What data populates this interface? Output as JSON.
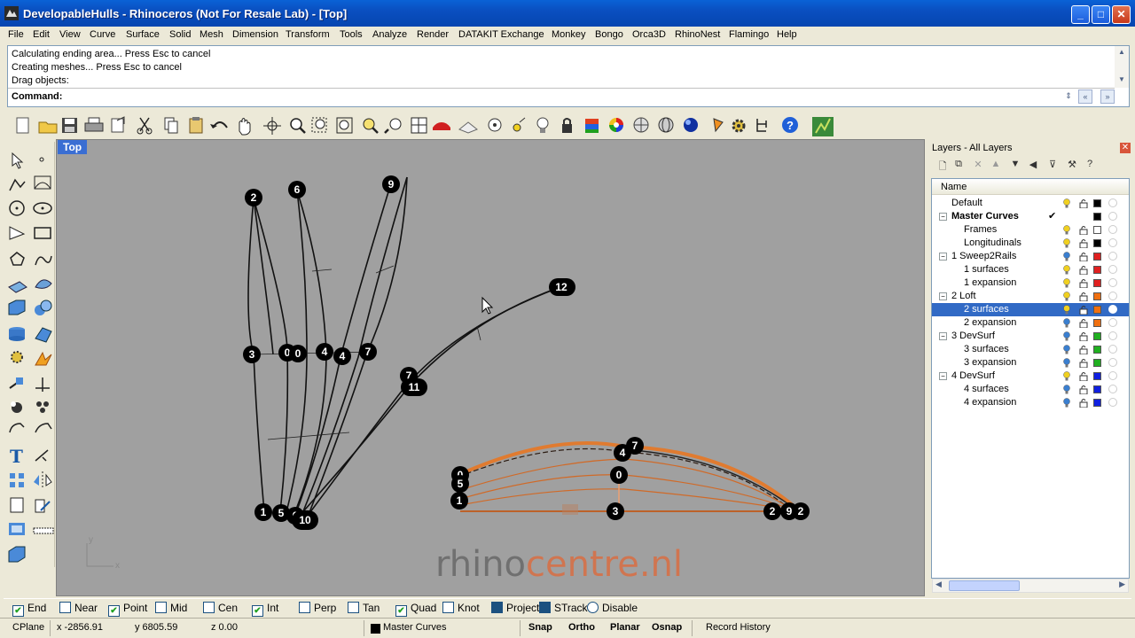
{
  "window": {
    "title": "DevelopableHulls - Rhinoceros (Not For Resale Lab) - [Top]",
    "buttons": {
      "minimize": "_",
      "maximize": "□",
      "close": "✕"
    }
  },
  "menu": [
    "File",
    "Edit",
    "View",
    "Curve",
    "Surface",
    "Solid",
    "Mesh",
    "Dimension",
    "Transform",
    "Tools",
    "Analyze",
    "Render",
    "DATAKIT Exchange",
    "Monkey",
    "Bongo",
    "Orca3D",
    "RhinoNest",
    "Flamingo",
    "Help"
  ],
  "command": {
    "history": [
      "Calculating ending area... Press Esc to cancel",
      "Creating meshes... Press Esc to cancel",
      "Drag objects:"
    ],
    "label": "Command:",
    "value": ""
  },
  "viewport": {
    "name": "Top",
    "watermark_a": "rhino",
    "watermark_b": "centre.nl",
    "axis_y": "y",
    "axis_x": "x",
    "labels_left": [
      "2",
      "6",
      "9",
      "12",
      "3",
      "0",
      "0",
      "4",
      "4",
      "7",
      "7",
      "11",
      "1",
      "5",
      "0",
      "10"
    ],
    "labels_right": [
      "7",
      "4",
      "0",
      "0",
      "5",
      "1",
      "3",
      "2",
      "9",
      "2"
    ]
  },
  "layers": {
    "title": "Layers - All Layers",
    "column": "Name",
    "rows": [
      {
        "name": "Default",
        "indent": 0,
        "bold": false,
        "expander": "",
        "current": false,
        "bulb": "#f0d020",
        "color": "#000000"
      },
      {
        "name": "Master Curves",
        "indent": 0,
        "bold": true,
        "expander": "−",
        "current": true,
        "bulb": "",
        "color": "#000000"
      },
      {
        "name": "Frames",
        "indent": 1,
        "bold": false,
        "expander": "",
        "current": false,
        "bulb": "#f0d020",
        "color": "#ffffff"
      },
      {
        "name": "Longitudinals",
        "indent": 1,
        "bold": false,
        "expander": "",
        "current": false,
        "bulb": "#f0d020",
        "color": "#000000"
      },
      {
        "name": "1 Sweep2Rails",
        "indent": 0,
        "bold": false,
        "expander": "−",
        "current": false,
        "bulb": "#3a7fd0",
        "color": "#e02020"
      },
      {
        "name": "1 surfaces",
        "indent": 1,
        "bold": false,
        "expander": "",
        "current": false,
        "bulb": "#f0d020",
        "color": "#e02020"
      },
      {
        "name": "1 expansion",
        "indent": 1,
        "bold": false,
        "expander": "",
        "current": false,
        "bulb": "#f0d020",
        "color": "#e02020"
      },
      {
        "name": "2 Loft",
        "indent": 0,
        "bold": false,
        "expander": "−",
        "current": false,
        "bulb": "#f0d020",
        "color": "#f07010"
      },
      {
        "name": "2 surfaces",
        "indent": 1,
        "bold": false,
        "expander": "",
        "current": false,
        "bulb": "#f0d020",
        "color": "#f07010",
        "selected": true
      },
      {
        "name": "2 expansion",
        "indent": 1,
        "bold": false,
        "expander": "",
        "current": false,
        "bulb": "#3a7fd0",
        "color": "#f07010"
      },
      {
        "name": "3 DevSurf",
        "indent": 0,
        "bold": false,
        "expander": "−",
        "current": false,
        "bulb": "#3a7fd0",
        "color": "#20b020"
      },
      {
        "name": "3 surfaces",
        "indent": 1,
        "bold": false,
        "expander": "",
        "current": false,
        "bulb": "#3a7fd0",
        "color": "#20b020"
      },
      {
        "name": "3 expansion",
        "indent": 1,
        "bold": false,
        "expander": "",
        "current": false,
        "bulb": "#3a7fd0",
        "color": "#20b020"
      },
      {
        "name": "4 DevSurf",
        "indent": 0,
        "bold": false,
        "expander": "−",
        "current": false,
        "bulb": "#f0d020",
        "color": "#1020e0"
      },
      {
        "name": "4 surfaces",
        "indent": 1,
        "bold": false,
        "expander": "",
        "current": false,
        "bulb": "#3a7fd0",
        "color": "#1020e0"
      },
      {
        "name": "4 expansion",
        "indent": 1,
        "bold": false,
        "expander": "",
        "current": false,
        "bulb": "#3a7fd0",
        "color": "#1020e0"
      }
    ]
  },
  "osnap": [
    {
      "label": "End",
      "checked": true
    },
    {
      "label": "Near",
      "checked": false
    },
    {
      "label": "Point",
      "checked": true
    },
    {
      "label": "Mid",
      "checked": false
    },
    {
      "label": "Cen",
      "checked": false
    },
    {
      "label": "Int",
      "checked": true
    },
    {
      "label": "Perp",
      "checked": false
    },
    {
      "label": "Tan",
      "checked": false
    },
    {
      "label": "Quad",
      "checked": true
    },
    {
      "label": "Knot",
      "checked": false
    },
    {
      "label": "Project",
      "checked": false,
      "filled": true
    },
    {
      "label": "STrack",
      "checked": false,
      "filled": true
    },
    {
      "label": "Disable",
      "checked": false,
      "round": true
    }
  ],
  "status": {
    "cplane": "CPlane",
    "x": "x -2856.91",
    "y": "y 6805.59",
    "z": "z 0.00",
    "layer": "Master Curves",
    "snap": "Snap",
    "ortho": "Ortho",
    "planar": "Planar",
    "osnap": "Osnap",
    "record": "Record History"
  },
  "toolbar_icons": [
    "new-icon",
    "open-icon",
    "save-icon",
    "print-icon",
    "import-icon",
    "cut-icon",
    "copy-icon",
    "paste-icon",
    "undo-icon",
    "pan-icon",
    "rotate-view-icon",
    "zoom-icon",
    "zoom-window-icon",
    "zoom-extents-icon",
    "zoom-selected-icon",
    "zoom-previous-icon",
    "four-viewports-icon",
    "car-icon",
    "grid-icon",
    "target-icon",
    "osnap-icon",
    "light-icon",
    "lock-icon",
    "layer-icon",
    "color-wheel-icon",
    "sphere-icon",
    "mesh-sphere-icon",
    "render-sphere-icon",
    "flag-icon",
    "settings-icon",
    "tree-icon",
    "help-icon",
    "plugin-icon"
  ],
  "left_icons": [
    "select-icon",
    "point-icon",
    "polyline-icon",
    "curve-icon",
    "circle-icon",
    "ellipse-icon",
    "arc-icon",
    "rectangle-icon",
    "polygon-icon",
    "freeform-icon",
    "surface-icon",
    "patch-icon",
    "box-icon",
    "boolean-icon",
    "cylinder-icon",
    "mesh-icon",
    "transform-icon",
    "explode-icon",
    "trim-icon",
    "split-icon",
    "group-icon",
    "fillet-icon",
    "offset-icon",
    "extend-icon",
    "text-icon",
    "dimension-icon",
    "array-icon",
    "mirror-icon",
    "layout-icon",
    "analyze-icon",
    "display-icon",
    "block-icon",
    "cplane-icon",
    "view-icon"
  ]
}
